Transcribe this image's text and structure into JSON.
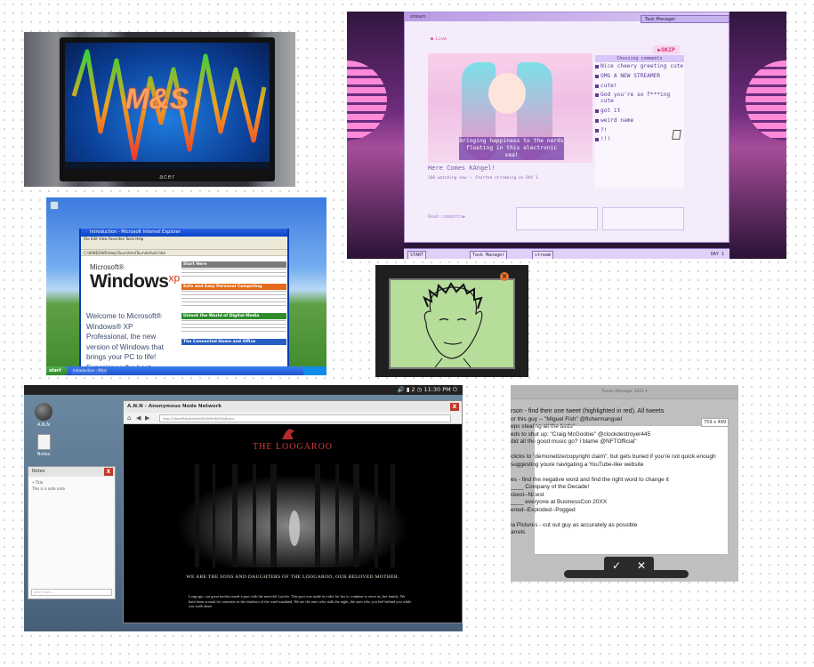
{
  "monitor_card": {
    "logo_text": "M&S",
    "brand": "acer"
  },
  "xp_card": {
    "ie_title": "Introduction - Microsoft Internet Explorer",
    "ie_menu": "File  Edit  View  Favorites  Tools  Help",
    "ie_address": "C:\\WINDOWS\\Help\\Tours\\htmlTour\\default.htm",
    "logo_microsoft": "Microsoft®",
    "logo_windows": "Windows",
    "logo_xp": "xp",
    "welcome": "Welcome to Microsoft® Windows® XP Professional, the new version of Windows that brings your PC to life! Experience the best. Experience Windows XP. Windows XP really delivers! Just click a link on the right to",
    "sections": [
      {
        "title": "Start Here",
        "color": "#7a7a7a"
      },
      {
        "title": "Safe and Easy Personal Computing",
        "color": "#e46a1a"
      },
      {
        "title": "Unlock the World of Digital Media",
        "color": "#2e8c2e"
      },
      {
        "title": "The Connected Home and Office",
        "color": "#2760c4"
      }
    ],
    "start_label": "start",
    "task_label": "Introduction - Micro..."
  },
  "stream_card": {
    "window_title": "stream",
    "task_manager_title": "Task Manager",
    "live_label": "● Live",
    "skip_label": "▶SKIP",
    "caption_line1": "Bringing happiness to the nerds",
    "caption_line2": "floating in this electronic sea!",
    "chat_header": "Choosing comments",
    "chat": [
      "Nice cheery greeting cute",
      "OMG A NEW STREAMER",
      "cute!",
      "God you're so f***ing cute",
      "got it",
      "weird name",
      "?!",
      "!!!"
    ],
    "streamer_name": "Here Comes KAngel!",
    "status": "160 watching now ・ Started streaming on DAY 1",
    "read_comments": "Read comments▶",
    "taskbar": {
      "start": "START",
      "task_manager": "Task Manager",
      "stream": "stream",
      "day": "DAY 1"
    }
  },
  "drawing_card": {
    "close_glyph": "×"
  },
  "ann_card": {
    "status_time": "🔊 ▮ 2 ◷ 11:30 PM ⏻",
    "desktop_icons": [
      {
        "label": "A.N.N",
        "icon": "monitor-icon"
      },
      {
        "label": "Notes",
        "icon": "notes-icon"
      }
    ],
    "notes_title": "Notes",
    "notes_close": "X",
    "notes_lines": [
      "• Title",
      "This is a note note"
    ],
    "notes_input": "enter note...",
    "browser_title": "A.N.N - Anonymous Node Network",
    "browser_close": "X",
    "url": "http://10anHR8u0sk0Jskd9LGBHr8d3f2s8f.ann",
    "site_title": "THE LOOGAROO",
    "tagline": "WE ARE THE SONS AND DAUGHTERS OF THE LOOGAROO, OUR BELOVED MOTHER.",
    "lore": "Long ago, our great mother made a pact with the merciful Lucifer. This pact was made in order for her to continue to serve us, her family. We have been around for centuries in the shadows of the cruel mankind. We are the ones who stalk the night, the ones who you feel behind you while you walk alone."
  },
  "doc_card": {
    "doc_title": "Tussle Manager 2022 ▾",
    "lines": [
      "rson - find their one tweet (highlighted in red). All tweets",
      "or this guy -- \"Miguel Fish\" @fishermanguel",
      "eps stealing all the birds\"",
      "eds to shut up: \"Craig McGoobie\" @clockdestroyer445",
      "did all the good music go? I blame @NFTOfficial\"",
      "",
      "clicks to \"demonetize/copyright claim\", but gets buried if you're not quick enough",
      "suggesting youre navigating a YouTube-like website",
      "",
      "es - find the negative word and find the right word to change it",
      "____ Company of the Decade!",
      "ckest--Nicest",
      "____ everyone at BusinessCon 20XX",
      "ened--Exploded--Pogged",
      "",
      "ia Pictures - cut out guy as accurately as possible",
      "arrels"
    ],
    "size_label": "759 x 489",
    "confirm_glyph": "✓",
    "cancel_glyph": "✕"
  }
}
